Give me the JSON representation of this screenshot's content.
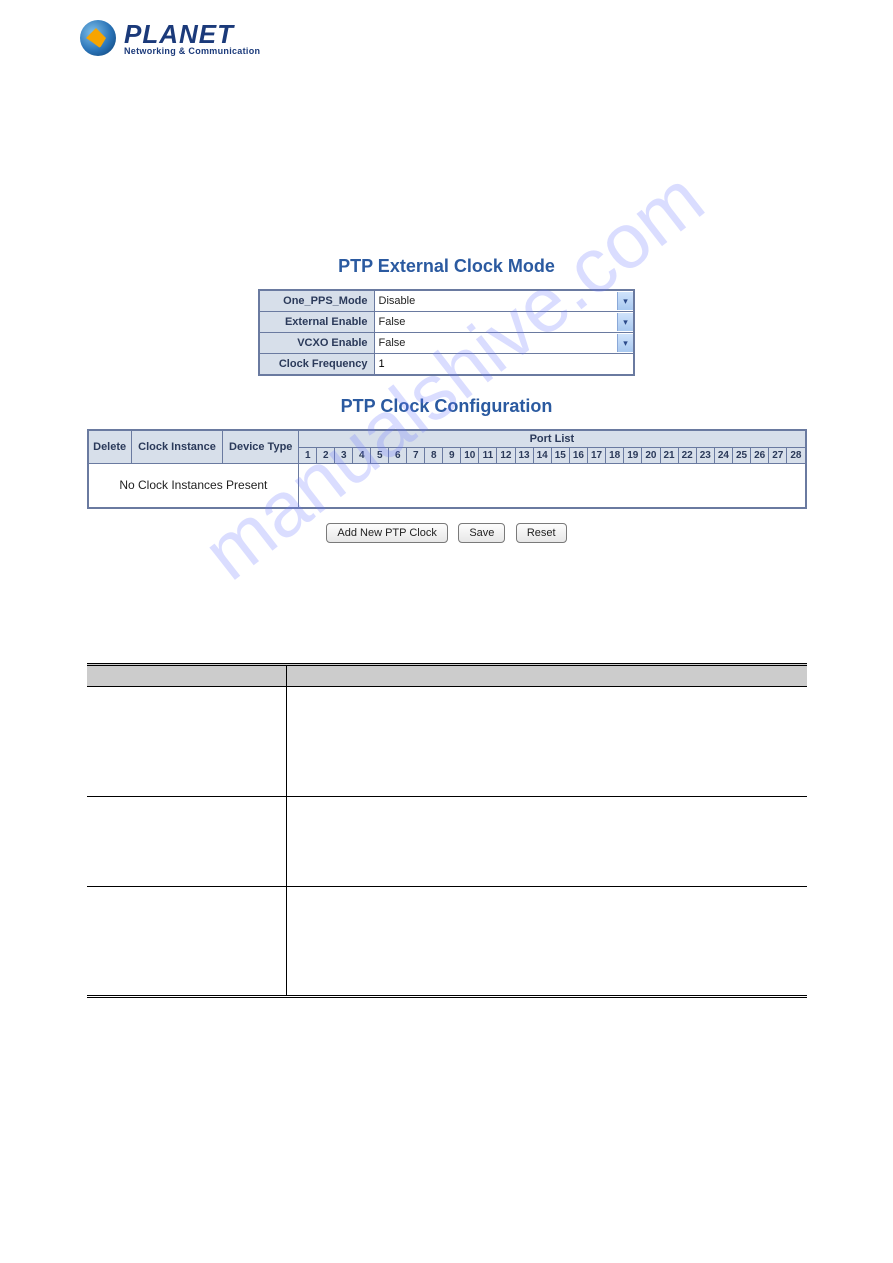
{
  "logo": {
    "brand": "PLANET",
    "tagline": "Networking & Communication"
  },
  "watermark": "manualshive.com",
  "sections": {
    "ext_title": "PTP External Clock Mode",
    "cfg_title": "PTP Clock Configuration"
  },
  "ext_clock": {
    "rows": [
      {
        "label": "One_PPS_Mode",
        "value": "Disable",
        "type": "select"
      },
      {
        "label": "External Enable",
        "value": "False",
        "type": "select"
      },
      {
        "label": "VCXO Enable",
        "value": "False",
        "type": "select"
      },
      {
        "label": "Clock Frequency",
        "value": "1",
        "type": "input"
      }
    ]
  },
  "cfg": {
    "headers": {
      "delete": "Delete",
      "clock_instance": "Clock Instance",
      "device_type": "Device Type",
      "port_list": "Port List"
    },
    "ports": [
      "1",
      "2",
      "3",
      "4",
      "5",
      "6",
      "7",
      "8",
      "9",
      "10",
      "11",
      "12",
      "13",
      "14",
      "15",
      "16",
      "17",
      "18",
      "19",
      "20",
      "21",
      "22",
      "23",
      "24",
      "25",
      "26",
      "27",
      "28"
    ],
    "empty_msg": "No Clock Instances Present"
  },
  "buttons": {
    "add": "Add New PTP Clock",
    "save": "Save",
    "reset": "Reset"
  },
  "desc": {
    "header_obj": "",
    "header_desc": ""
  }
}
